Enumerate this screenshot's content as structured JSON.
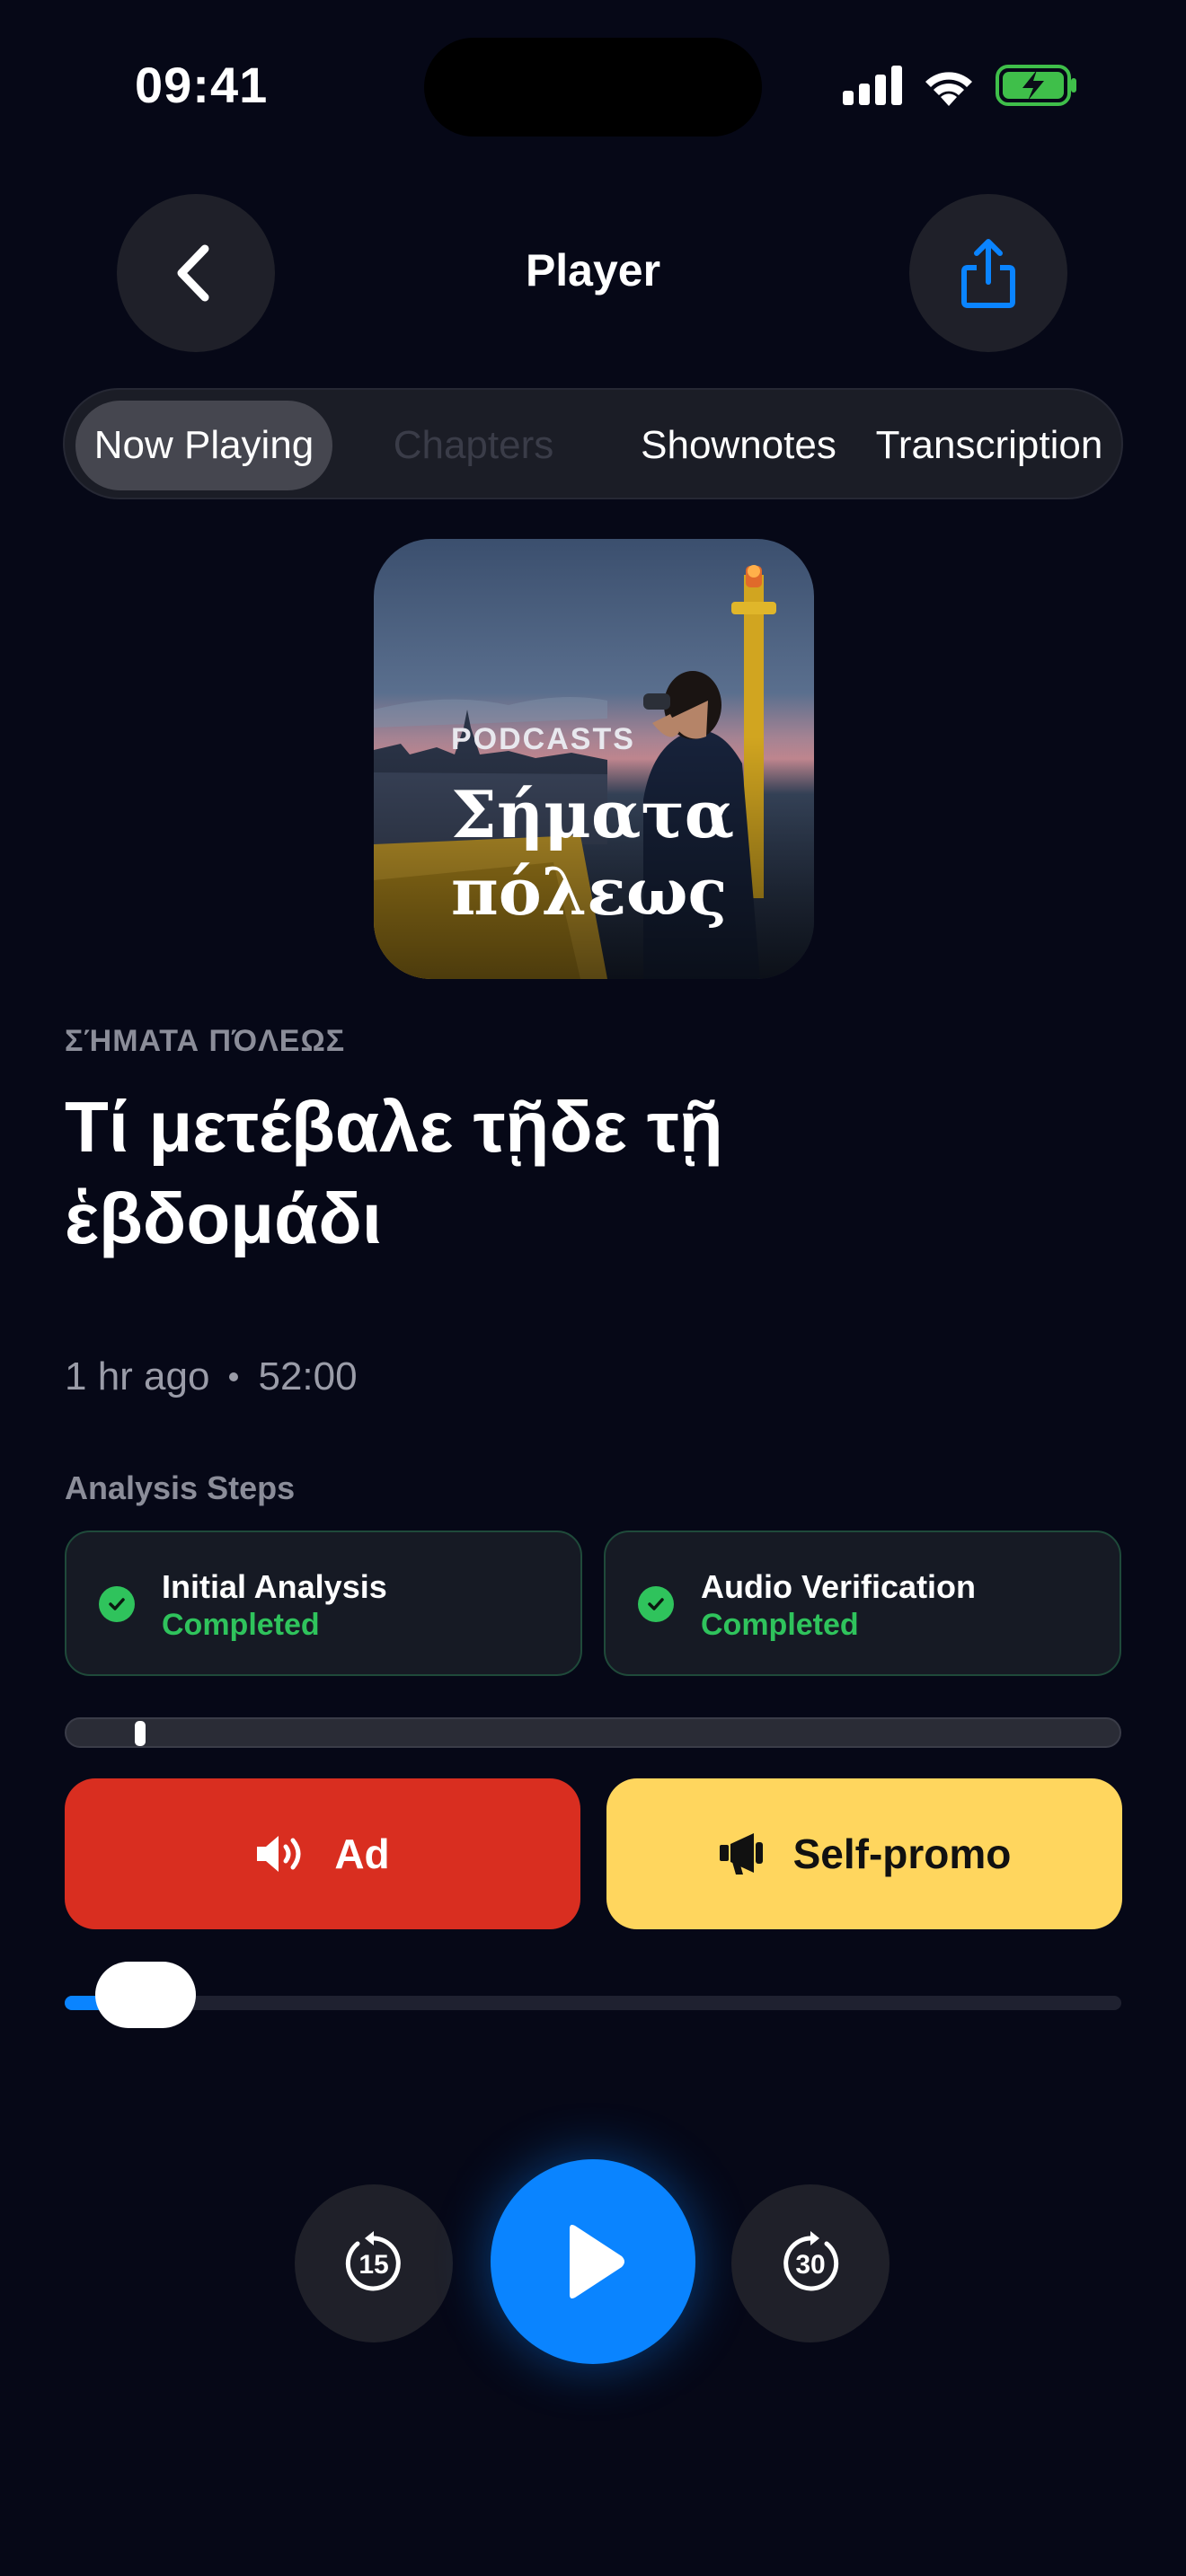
{
  "status_bar": {
    "time": "09:41"
  },
  "header": {
    "title": "Player",
    "back_icon": "chevron-left-icon",
    "share_icon": "share-icon"
  },
  "tabs": [
    {
      "label": "Now Playing",
      "active": true
    },
    {
      "label": "Chapters",
      "active": false,
      "disabled": true
    },
    {
      "label": "Shownotes",
      "active": false
    },
    {
      "label": "Transcription",
      "active": false
    }
  ],
  "artwork": {
    "kicker": "PODCASTS",
    "title": "Σήματα πόλεως"
  },
  "episode": {
    "show_name": "ΣΉΜΑΤΑ ΠΌΛΕΩΣ",
    "title": "Τί μετέβαλε τῇδε τῇ ἑβδομάδι",
    "age": "1 hr ago",
    "duration": "52:00"
  },
  "analysis": {
    "label": "Analysis Steps",
    "steps": [
      {
        "name": "Initial Analysis",
        "status": "Completed"
      },
      {
        "name": "Audio Verification",
        "status": "Completed"
      }
    ]
  },
  "segments": {
    "ad_label": "Ad",
    "promo_label": "Self-promo"
  },
  "playback": {
    "progress": 0.07,
    "skip_back_seconds": "15",
    "skip_forward_seconds": "30"
  },
  "colors": {
    "accent": "#0a84ff",
    "success": "#2fc35c",
    "ad": "#d92e20",
    "promo": "#ffd65e",
    "background": "#060817"
  }
}
